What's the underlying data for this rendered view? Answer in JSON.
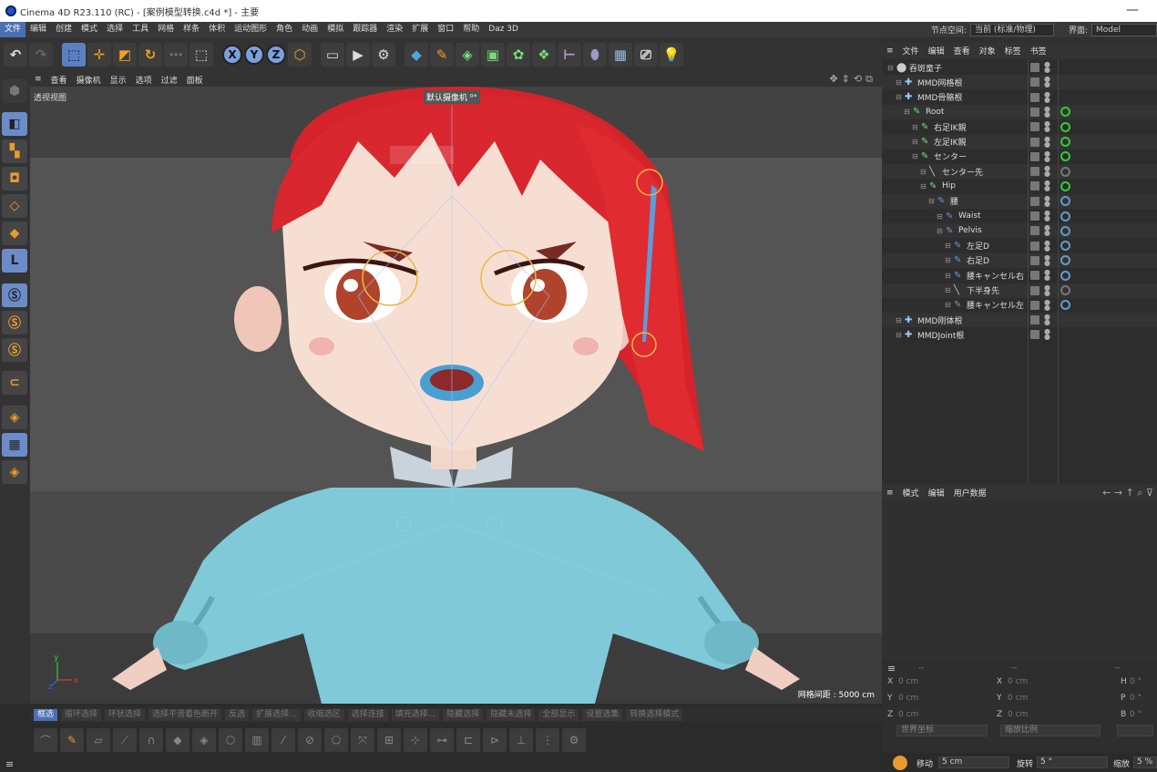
{
  "titlebar": {
    "title": "Cinema 4D R23.110 (RC) - [案例模型转换.c4d *] - 主要",
    "minimize": "—"
  },
  "menu": {
    "items": [
      "文件",
      "编辑",
      "创建",
      "模式",
      "选择",
      "工具",
      "网格",
      "样条",
      "体积",
      "运动图形",
      "角色",
      "动画",
      "模拟",
      "跟踪器",
      "渲染",
      "扩展",
      "窗口",
      "帮助",
      "Daz 3D"
    ],
    "node_space_label": "节点空间:",
    "node_space_value": "当前 (标准/物理)",
    "layout_label": "界面:",
    "layout_value": "Model"
  },
  "toolbar": {
    "icons": [
      "undo-icon",
      "redo-icon",
      "select-icon",
      "move-icon",
      "scale-icon",
      "rotate-icon",
      "recent-tool-icon",
      "live-select-icon",
      "x-axis-icon",
      "y-axis-icon",
      "z-axis-icon",
      "coordinate-system-icon",
      "render-view-icon",
      "render-icon",
      "render-settings-icon",
      "cube-icon",
      "pen-icon",
      "subdivision-icon",
      "extrude-icon",
      "cloner-icon",
      "array-icon",
      "bend-icon",
      "floor-icon",
      "camera-icon",
      "light-icon"
    ],
    "x": "X",
    "y": "Y",
    "z": "Z"
  },
  "viewport": {
    "menu": [
      "查看",
      "摄像机",
      "显示",
      "选项",
      "过滤",
      "面板"
    ],
    "label": "透视视图",
    "camera": "默认摄像机 ⁰°",
    "grid": "网格间距 : 5000 cm",
    "axis_x": "x",
    "axis_y": "y",
    "axis_z": "z"
  },
  "objects": {
    "menu": [
      "文件",
      "编辑",
      "查看",
      "对象",
      "标签",
      "书签"
    ],
    "rows": [
      {
        "name": "吞斑童子",
        "indent": 0,
        "icon": "null-icon",
        "tag": ""
      },
      {
        "name": "MMD网格根",
        "indent": 1,
        "icon": "mesh-root-icon",
        "tag": ""
      },
      {
        "name": "MMD骨骼根",
        "indent": 1,
        "icon": "bone-root-icon",
        "tag": ""
      },
      {
        "name": "Root",
        "indent": 2,
        "icon": "bone-icon",
        "tag": "g"
      },
      {
        "name": "右足IK親",
        "indent": 3,
        "icon": "bone-icon",
        "tag": "g"
      },
      {
        "name": "左足IK親",
        "indent": 3,
        "icon": "bone-icon",
        "tag": "g"
      },
      {
        "name": "センター",
        "indent": 3,
        "icon": "bone-icon",
        "tag": "g"
      },
      {
        "name": "センター先",
        "indent": 4,
        "icon": "bone-tip-icon",
        "tag": "gr"
      },
      {
        "name": "Hip",
        "indent": 4,
        "icon": "bone-icon",
        "tag": "g"
      },
      {
        "name": "腰",
        "indent": 5,
        "icon": "bone-icon",
        "tag": "p"
      },
      {
        "name": "Waist",
        "indent": 6,
        "icon": "bone-icon",
        "tag": "p"
      },
      {
        "name": "Pelvis",
        "indent": 6,
        "icon": "bone-icon",
        "tag": "p"
      },
      {
        "name": "左足D",
        "indent": 7,
        "icon": "bone-icon",
        "tag": "p"
      },
      {
        "name": "右足D",
        "indent": 7,
        "icon": "bone-icon",
        "tag": "p"
      },
      {
        "name": "腰キャンセル右",
        "indent": 7,
        "icon": "bone-icon",
        "tag": "p"
      },
      {
        "name": "下半身先",
        "indent": 7,
        "icon": "bone-tip-icon",
        "tag": "gr"
      },
      {
        "name": "腰キャンセル左",
        "indent": 7,
        "icon": "bone-icon",
        "tag": "p"
      },
      {
        "name": "MMD刚体根",
        "indent": 1,
        "icon": "rigid-root-icon",
        "tag": ""
      },
      {
        "name": "MMDJoint根",
        "indent": 1,
        "icon": "joint-root-icon",
        "tag": ""
      }
    ]
  },
  "attributes": {
    "menu": [
      "模式",
      "编辑",
      "用户数据"
    ]
  },
  "coordinates": {
    "header": [
      "--",
      "--",
      "--"
    ],
    "rows": [
      {
        "a": "X",
        "av": "0 cm",
        "b": "X",
        "bv": "0 cm",
        "c": "H",
        "cv": "0 °"
      },
      {
        "a": "Y",
        "av": "0 cm",
        "b": "Y",
        "bv": "0 cm",
        "c": "P",
        "cv": "0 °"
      },
      {
        "a": "Z",
        "av": "0 cm",
        "b": "Z",
        "bv": "0 cm",
        "c": "B",
        "cv": "0 °"
      }
    ],
    "world": "世界坐标",
    "scale": "缩放比例"
  },
  "bottom": {
    "buttons": [
      "框选",
      "循环选择",
      "环状选择",
      "选择平滑着色断开",
      "反选",
      "扩展选择...",
      "收缩选区",
      "选择连接",
      "填充选择...",
      "隐藏选择",
      "隐藏未选择",
      "全部显示",
      "设置选集",
      "转换选择模式"
    ]
  },
  "snap": {
    "move_label": "移动",
    "move_value": "5 cm",
    "rotate_label": "旋转",
    "rotate_value": "5 °",
    "scale_label": "缩放",
    "scale_value": "5 %"
  },
  "colors": {
    "accent": "#4a6fb3",
    "hair": "#d4232a",
    "sweater": "#7fc9d9",
    "skin": "#f6dfd2"
  }
}
